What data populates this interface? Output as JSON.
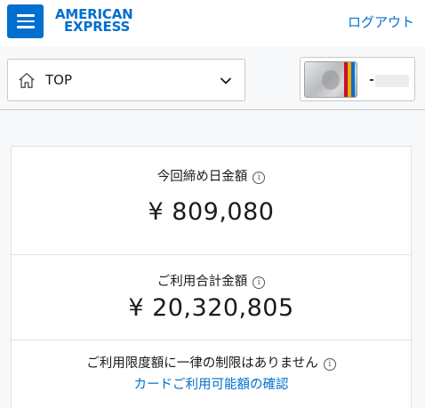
{
  "header": {
    "logo_line1": "AMERICAN",
    "logo_line2": "EXPRESS",
    "logout_label": "ログアウト",
    "menu_icon": "hamburger-menu-icon",
    "brand_color": "#006fcf"
  },
  "nav": {
    "page_select_value": "TOP",
    "home_icon": "home-icon",
    "chevron_icon": "chevron-down-icon",
    "card_last_digits_prefix": "-"
  },
  "summary": {
    "closing_label": "今回締め日金額",
    "closing_amount": "¥ 809,080",
    "usage_label": "ご利用合計金額",
    "usage_amount": "¥ 20,320,805",
    "limit_label": "ご利用限度額に一律の制限はありません",
    "limit_link": "カードご利用可能額の確認",
    "info_icon_glyph": "i"
  }
}
